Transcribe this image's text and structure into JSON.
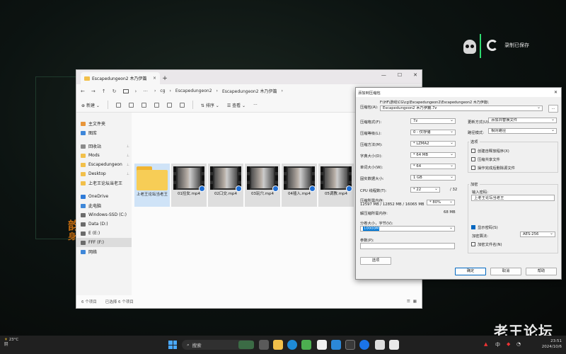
{
  "overlay": {
    "record_status": "录制已保存",
    "watermark": "老王论坛",
    "game_text_1": "韵",
    "game_text_2": "身"
  },
  "explorer": {
    "tab_title": "Escapedungeon2 木乃伊篇",
    "tab_close": "×",
    "tab_add": "+",
    "window_controls": {
      "minimize": "—",
      "maximize": "☐",
      "close": "✕"
    },
    "address": {
      "nav_back": "←",
      "nav_forward": "→",
      "nav_up": "↑",
      "refresh": "↻",
      "more": "···",
      "crumbs": [
        "cg",
        "Escapedungeon2",
        "Escapedungeon2 木乃伊篇"
      ],
      "search_placeholder": "在 E"
    },
    "toolbar": {
      "new_label": "新建",
      "sort_label": "排序",
      "view_label": "查看",
      "more_label": "···"
    },
    "nav": {
      "items": [
        {
          "label": "主文件夹",
          "color": "#e8953a"
        },
        {
          "label": "图库",
          "color": "#3e87d9"
        },
        {
          "label": "回收站",
          "color": "#8a8a8a",
          "pinned": true
        },
        {
          "label": "Mods",
          "color": "#f2c04a",
          "pinned": true
        },
        {
          "label": "Escapedungeon",
          "color": "#f2c04a",
          "pinned": true
        },
        {
          "label": "Desktop",
          "color": "#f2c04a",
          "pinned": true
        },
        {
          "label": "上老王论坛当老王",
          "color": "#f2c04a"
        },
        {
          "label": "OneDrive",
          "color": "#2f7bd8"
        },
        {
          "label": "此电脑",
          "color": "#3e87d9"
        },
        {
          "label": "Windows-SSD (C:)",
          "color": "#6b6b6b"
        },
        {
          "label": "Data (D:)",
          "color": "#6b6b6b"
        },
        {
          "label": "E (E:)",
          "color": "#6b6b6b"
        },
        {
          "label": "FFF (F:)",
          "color": "#6b6b6b"
        },
        {
          "label": "网络",
          "color": "#3e87d9"
        }
      ]
    },
    "files": [
      {
        "name": "上老王论坛当老王",
        "kind": "folder"
      },
      {
        "name": "01捡女.mp4",
        "kind": "video"
      },
      {
        "name": "02口交.mp4",
        "kind": "video"
      },
      {
        "name": "03玩穴.mp4",
        "kind": "video"
      },
      {
        "name": "04插入.mp4",
        "kind": "video"
      },
      {
        "name": "05调教.mp4",
        "kind": "video"
      }
    ],
    "status": {
      "count": "6 个项目",
      "selected": "已选择 6 个项目"
    }
  },
  "dialog": {
    "title": "添加到压缩包",
    "archive_label": "压缩包(A):",
    "archive_path": "F:\\HF\\游戏\\CG\\cg\\Escapedungeon2\\Escapedungeon2 木乃伊篇\\",
    "archive_name": "Escapedungeon2 木乃伊篇.7z",
    "browse": "...",
    "format_label": "压缩格式(F):",
    "format_value": "7z",
    "level_label": "压缩等级(L):",
    "level_value": "0 - 仅存储",
    "method_label": "压缩方法(M):",
    "method_value": "* LZMA2",
    "dict_label": "字典大小(D):",
    "dict_value": "* 64 MB",
    "word_label": "单词大小(W):",
    "word_value": "* 64",
    "solid_label": "固实数据大小:",
    "solid_value": "1 GB",
    "cpu_label": "CPU 线程数(T):",
    "cpu_value": "* 22",
    "cpu_total": "/ 32",
    "mem_comp_label": "压缩所需内存:",
    "mem_comp_value": "12597 MB / 12852 MB / 16065 MB",
    "mem_comp_pct": "* 80%",
    "mem_decomp_label": "解压缩所需内存:",
    "mem_decomp_value": "68 MB",
    "split_label": "分卷大小，字节(V):",
    "split_value": "10000M",
    "params_label": "参数(P):",
    "options_button": "选项",
    "update_label": "更新方式(U):",
    "update_value": "添加并替换文件",
    "path_label": "路径模式:",
    "path_value": "相对路径",
    "group_options": "选项",
    "opt_sfx": "创建自释放程序(X)",
    "opt_shared": "压缩共享文件",
    "opt_delete": "操作完成后删除源文件",
    "encrypt_title": "加密",
    "password_label": "输入密码:",
    "password_value": "上老王论坛当老王",
    "show_password": "显示密码(S)",
    "enc_method_label": "加密算法:",
    "enc_method_value": "AES-256",
    "enc_names": "加密文件名(N)",
    "ok": "确定",
    "cancel": "取消",
    "help": "帮助"
  },
  "taskbar": {
    "temp": "23°C",
    "weather": "阴",
    "search_placeholder": "搜索",
    "time": "23:51",
    "date": "2024/10/6",
    "tray_text": "中"
  }
}
